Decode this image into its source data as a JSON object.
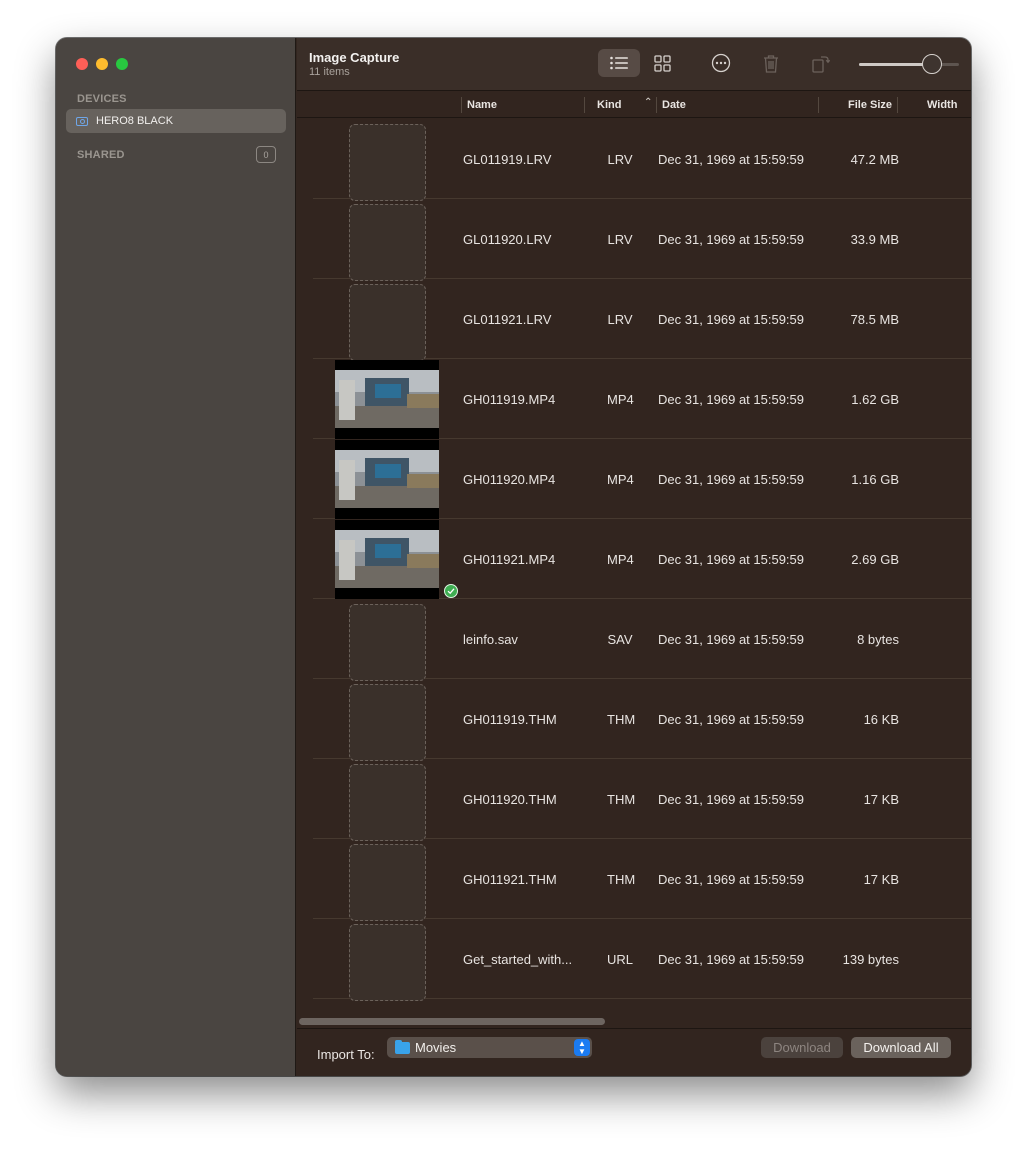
{
  "window": {
    "title": "Image Capture",
    "subtitle": "11 items"
  },
  "sidebar": {
    "devices_header": "DEVICES",
    "device_name": "HERO8 BLACK",
    "shared_header": "SHARED",
    "shared_count": "0"
  },
  "toolbar": {
    "buttons": [
      "list-view",
      "grid-view",
      "more-options",
      "delete",
      "rotate"
    ],
    "thumbnail_size_fraction": 0.73
  },
  "columns": {
    "name": "Name",
    "kind": "Kind",
    "date": "Date",
    "size": "File Size",
    "width": "Width"
  },
  "files": [
    {
      "name": "GL011919.LRV",
      "kind": "LRV",
      "date": "Dec 31, 1969 at 15:59:59",
      "size": "47.2 MB",
      "thumb": "placeholder"
    },
    {
      "name": "GL011920.LRV",
      "kind": "LRV",
      "date": "Dec 31, 1969 at 15:59:59",
      "size": "33.9 MB",
      "thumb": "placeholder"
    },
    {
      "name": "GL011921.LRV",
      "kind": "LRV",
      "date": "Dec 31, 1969 at 15:59:59",
      "size": "78.5 MB",
      "thumb": "placeholder"
    },
    {
      "name": "GH011919.MP4",
      "kind": "MP4",
      "date": "Dec 31, 1969 at 15:59:59",
      "size": "1.62 GB",
      "thumb": "video"
    },
    {
      "name": "GH011920.MP4",
      "kind": "MP4",
      "date": "Dec 31, 1969 at 15:59:59",
      "size": "1.16 GB",
      "thumb": "video"
    },
    {
      "name": "GH011921.MP4",
      "kind": "MP4",
      "date": "Dec 31, 1969 at 15:59:59",
      "size": "2.69 GB",
      "thumb": "video",
      "downloaded": true
    },
    {
      "name": "leinfo.sav",
      "kind": "SAV",
      "date": "Dec 31, 1969 at 15:59:59",
      "size": "8 bytes",
      "thumb": "placeholder"
    },
    {
      "name": "GH011919.THM",
      "kind": "THM",
      "date": "Dec 31, 1969 at 15:59:59",
      "size": "16 KB",
      "thumb": "placeholder"
    },
    {
      "name": "GH011920.THM",
      "kind": "THM",
      "date": "Dec 31, 1969 at 15:59:59",
      "size": "17 KB",
      "thumb": "placeholder"
    },
    {
      "name": "GH011921.THM",
      "kind": "THM",
      "date": "Dec 31, 1969 at 15:59:59",
      "size": "17 KB",
      "thumb": "placeholder"
    },
    {
      "name": "Get_started_with...",
      "kind": "URL",
      "date": "Dec 31, 1969 at 15:59:59",
      "size": "139 bytes",
      "thumb": "placeholder"
    }
  ],
  "bottom": {
    "import_label": "Import To:",
    "import_destination": "Movies",
    "download_label": "Download",
    "download_all_label": "Download All"
  },
  "colors": {
    "accent": "#1a7bf2",
    "close": "#fe5f57",
    "minimize": "#febc2e",
    "maximize": "#28c840",
    "success": "#3fae52"
  }
}
